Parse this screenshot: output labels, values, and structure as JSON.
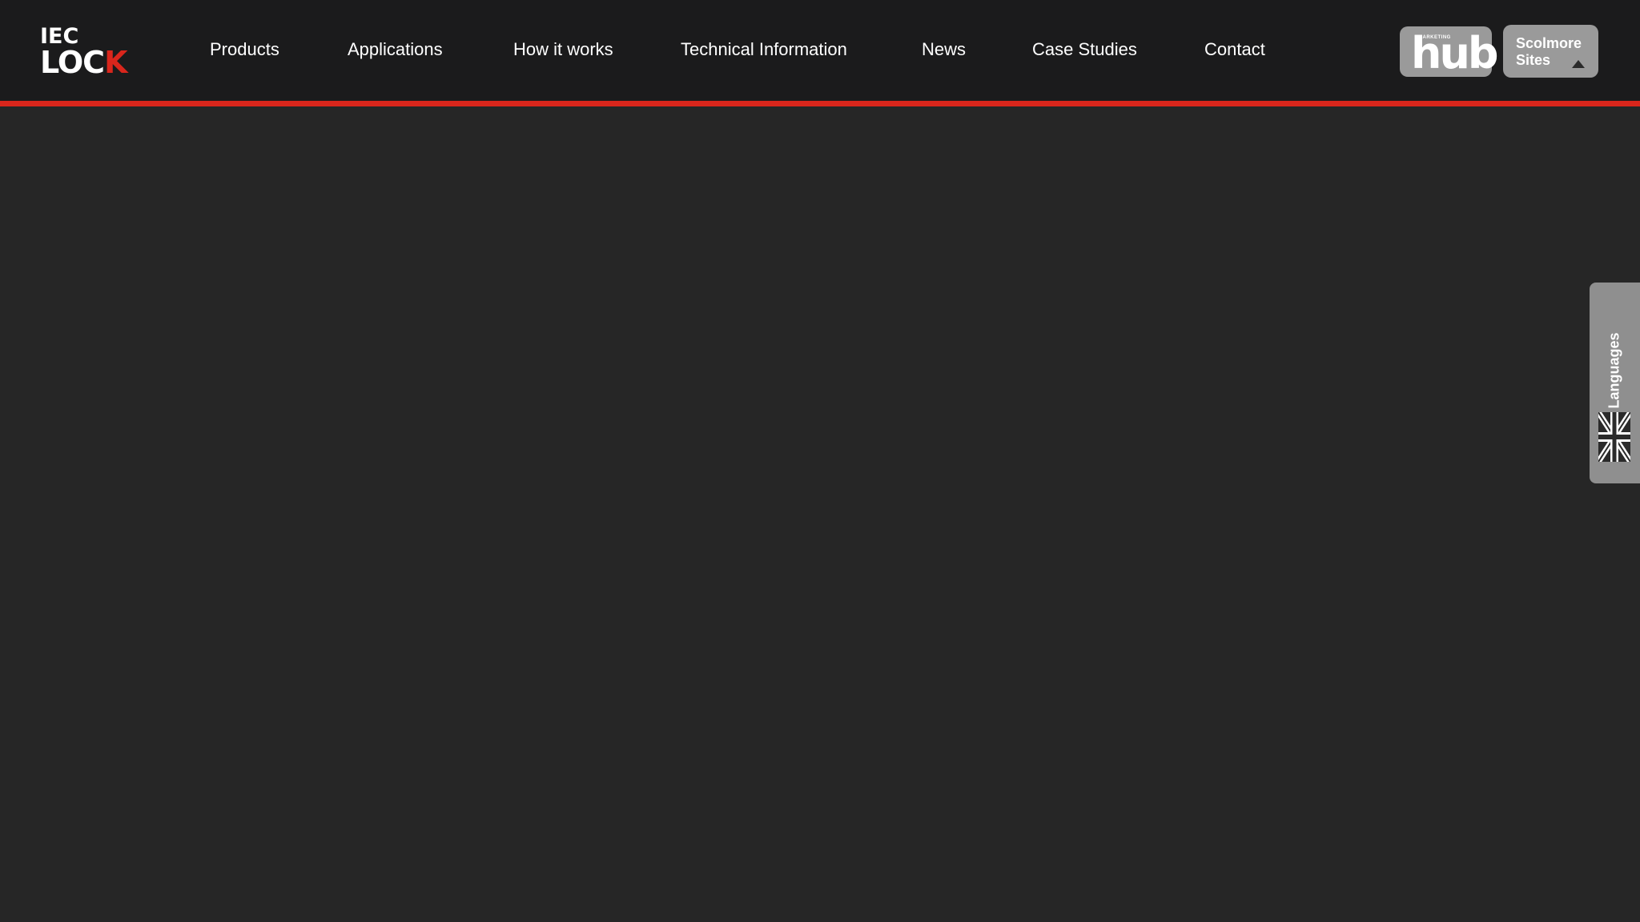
{
  "logo": {
    "line1": "IEC",
    "line2_main": "LOC",
    "line2_accent": "K"
  },
  "nav": {
    "items": [
      {
        "label": "Products"
      },
      {
        "label": "Applications"
      },
      {
        "label": "How it works"
      },
      {
        "label": "Technical Information"
      },
      {
        "label": "News"
      },
      {
        "label": "Case Studies"
      },
      {
        "label": "Contact"
      }
    ]
  },
  "hub": {
    "small": "MARKETING",
    "main": "hub"
  },
  "sites": {
    "label": "Scolmore Sites"
  },
  "languages": {
    "label": "Languages"
  },
  "colors": {
    "header_bg": "#1b1b1c",
    "page_bg": "#262626",
    "accent": "#d9261c",
    "button_bg": "#9a9a9a"
  }
}
